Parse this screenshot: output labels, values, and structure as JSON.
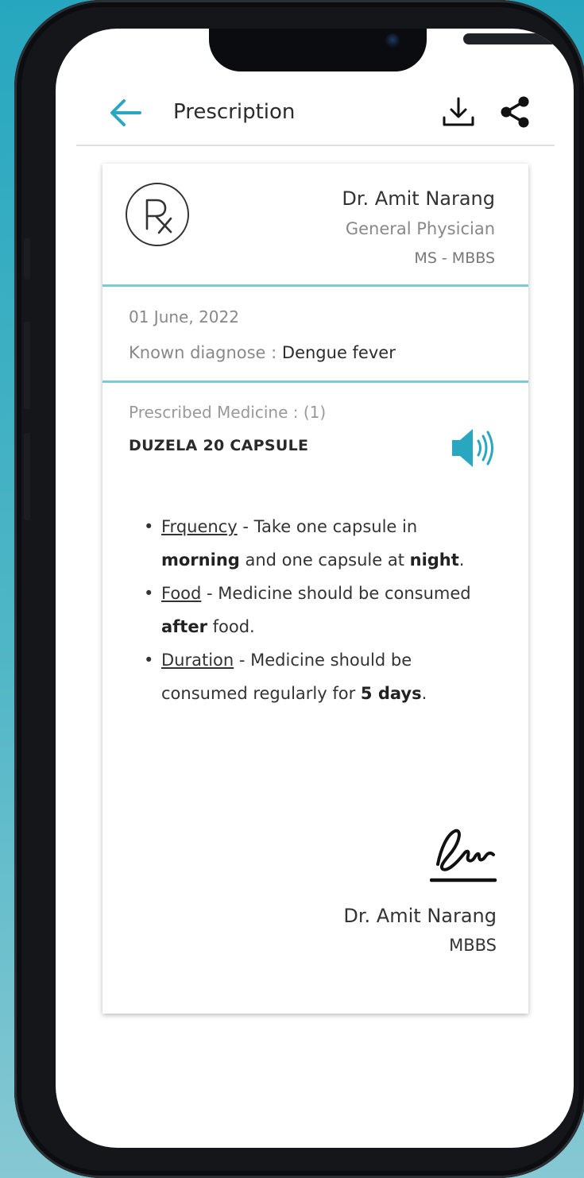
{
  "appbar": {
    "title": "Prescription"
  },
  "doctor": {
    "name": "Dr. Amit Narang",
    "specialty": "General Physician",
    "degree": "MS - MBBS"
  },
  "visit": {
    "date": "01 June, 2022",
    "diagnosis_label": "Known diagnose : ",
    "diagnosis_value": "Dengue fever"
  },
  "medicine": {
    "label": "Prescribed Medicine : (1)",
    "name": "DUZELA 20 CAPSULE",
    "instructions": {
      "frequency": {
        "label": "Frquency",
        "t1": " - Take one capsule in ",
        "b1": "morning",
        "t2": " and one capsule at ",
        "b2": "night",
        "t3": "."
      },
      "food": {
        "label": "Food",
        "t1": " - Medicine should be consumed ",
        "b1": "after",
        "t2": " food."
      },
      "duration": {
        "label": "Duration",
        "t1": " - Medicine should be consumed regularly for ",
        "b1": "5 days",
        "t2": "."
      }
    }
  },
  "signature": {
    "name": "Dr. Amit Narang",
    "degree": "MBBS"
  },
  "colors": {
    "accent": "#2aa7c0",
    "divider": "#7cc9d7",
    "background_gradient": [
      "#27a7bf",
      "#86c8d3"
    ]
  },
  "icons": [
    "back-arrow-icon",
    "download-icon",
    "share-icon",
    "rx-icon",
    "speaker-icon"
  ]
}
